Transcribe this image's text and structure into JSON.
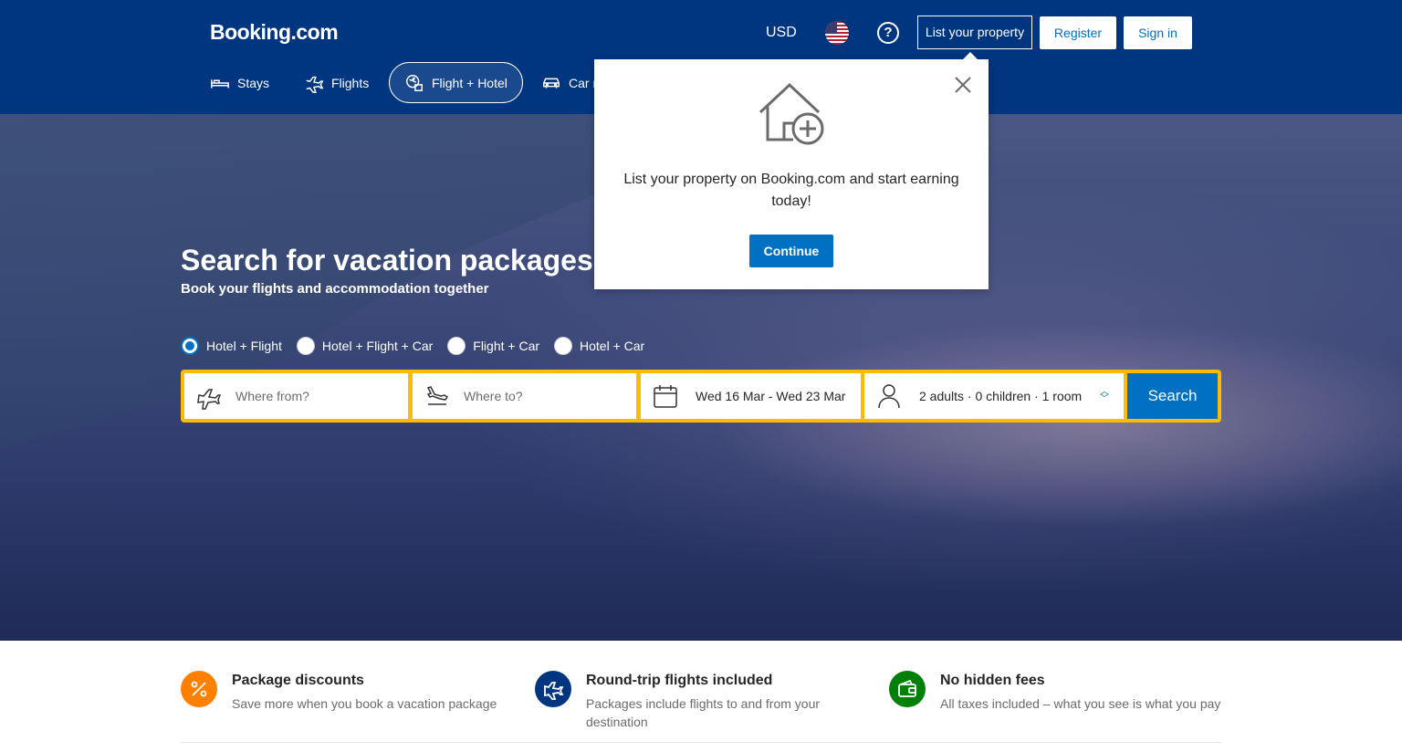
{
  "header": {
    "logo": "Booking.com",
    "currency": "USD",
    "help": "?",
    "list_property": "List your property",
    "register": "Register",
    "signin": "Sign in"
  },
  "nav": [
    {
      "label": "Stays",
      "icon": "bed-icon"
    },
    {
      "label": "Flights",
      "icon": "plane-icon"
    },
    {
      "label": "Flight + Hotel",
      "icon": "flight-hotel-icon",
      "active": true
    },
    {
      "label": "Car rentals",
      "icon": "car-icon"
    }
  ],
  "hero": {
    "title": "Search for vacation packages",
    "subtitle": "Book your flights and accommodation together"
  },
  "package_options": [
    {
      "label": "Hotel + Flight",
      "selected": true
    },
    {
      "label": "Hotel + Flight + Car",
      "selected": false
    },
    {
      "label": "Flight + Car",
      "selected": false
    },
    {
      "label": "Hotel + Car",
      "selected": false
    }
  ],
  "search": {
    "from_placeholder": "Where from?",
    "to_placeholder": "Where to?",
    "dates": "Wed 16 Mar - Wed 23 Mar",
    "guests": "2 adults · 0 children · 1 room",
    "button": "Search"
  },
  "popup": {
    "message": "List your property on Booking.com and start earning today!",
    "button": "Continue"
  },
  "features": [
    {
      "title": "Package discounts",
      "text": "Save more when you book a vacation package",
      "icon": "percent-icon",
      "color": "#ff8000"
    },
    {
      "title": "Round-trip flights included",
      "text": "Packages include flights to and from your destination",
      "icon": "plane-icon",
      "color": "#003580"
    },
    {
      "title": "No hidden fees",
      "text": "All taxes included – what you see is what you pay",
      "icon": "wallet-icon",
      "color": "#008009"
    }
  ],
  "colors": {
    "brand": "#003580",
    "accent": "#0071c2",
    "search_border": "#febb02"
  }
}
